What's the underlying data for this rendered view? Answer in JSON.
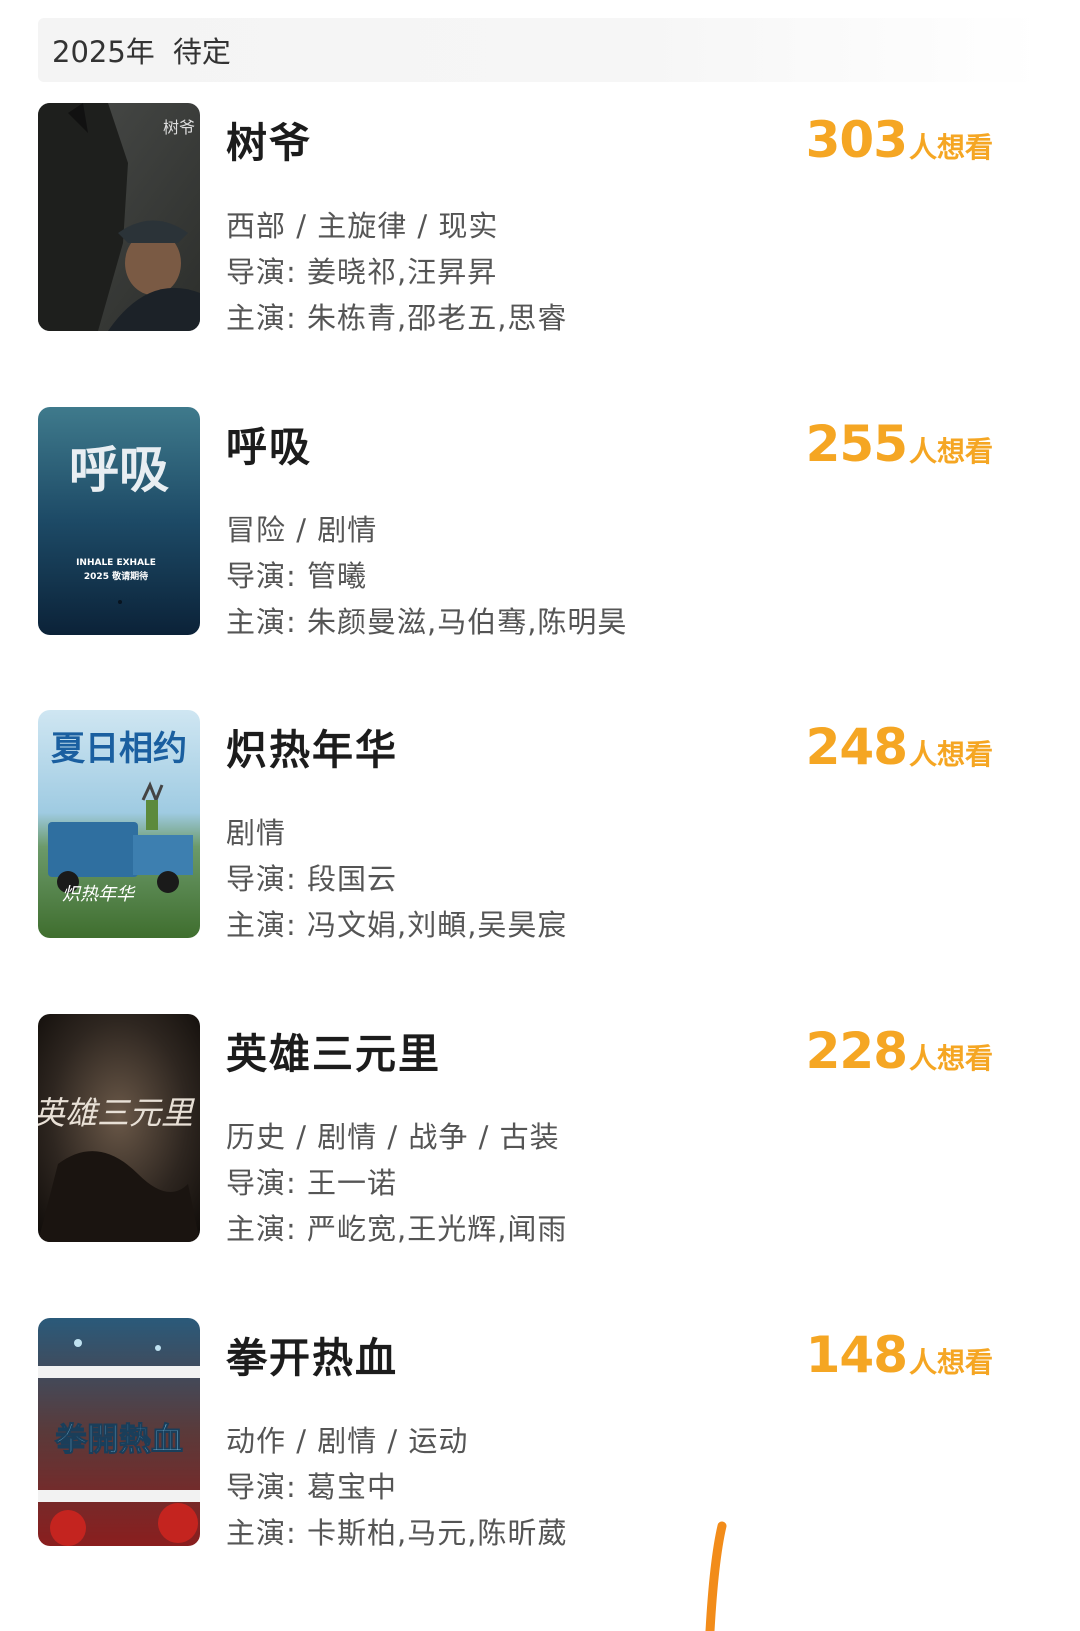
{
  "section": {
    "year": "2025年",
    "status": "待定"
  },
  "movies": [
    {
      "title": "树爷",
      "want_count": "303",
      "want_suffix": "人想看",
      "genres": "西部 / 主旋律 / 现实",
      "director": "导演: 姜晓祁,汪昇昇",
      "cast": "主演: 朱栋青,邵老五,思睿",
      "poster_text": "树爷"
    },
    {
      "title": "呼吸",
      "want_count": "255",
      "want_suffix": "人想看",
      "genres": "冒险 / 剧情",
      "director": "导演: 管曦",
      "cast": "主演: 朱颜曼滋,马伯骞,陈明昊",
      "poster_text": "呼吸",
      "poster_sub": "INHALE EXHALE",
      "poster_sub2": "2025 敬请期待"
    },
    {
      "title": "炽热年华",
      "want_count": "248",
      "want_suffix": "人想看",
      "genres": "剧情",
      "director": "导演: 段国云",
      "cast": "主演: 冯文娟,刘頔,吴昊宸",
      "poster_text": "夏日相约",
      "poster_sub": "炽热年华"
    },
    {
      "title": "英雄三元里",
      "want_count": "228",
      "want_suffix": "人想看",
      "genres": "历史 / 剧情 / 战争 / 古装",
      "director": "导演: 王一诺",
      "cast": "主演: 严屹宽,王光辉,闻雨",
      "poster_text": "英雄三元里"
    },
    {
      "title": "拳开热血",
      "want_count": "148",
      "want_suffix": "人想看",
      "genres": "动作 / 剧情 / 运动",
      "director": "导演: 葛宝中",
      "cast": "主演: 卡斯柏,马元,陈昕葳",
      "poster_text": "拳開熱血"
    }
  ],
  "colors": {
    "accent": "#f5a623",
    "header_bg": "#f4f4f4"
  }
}
